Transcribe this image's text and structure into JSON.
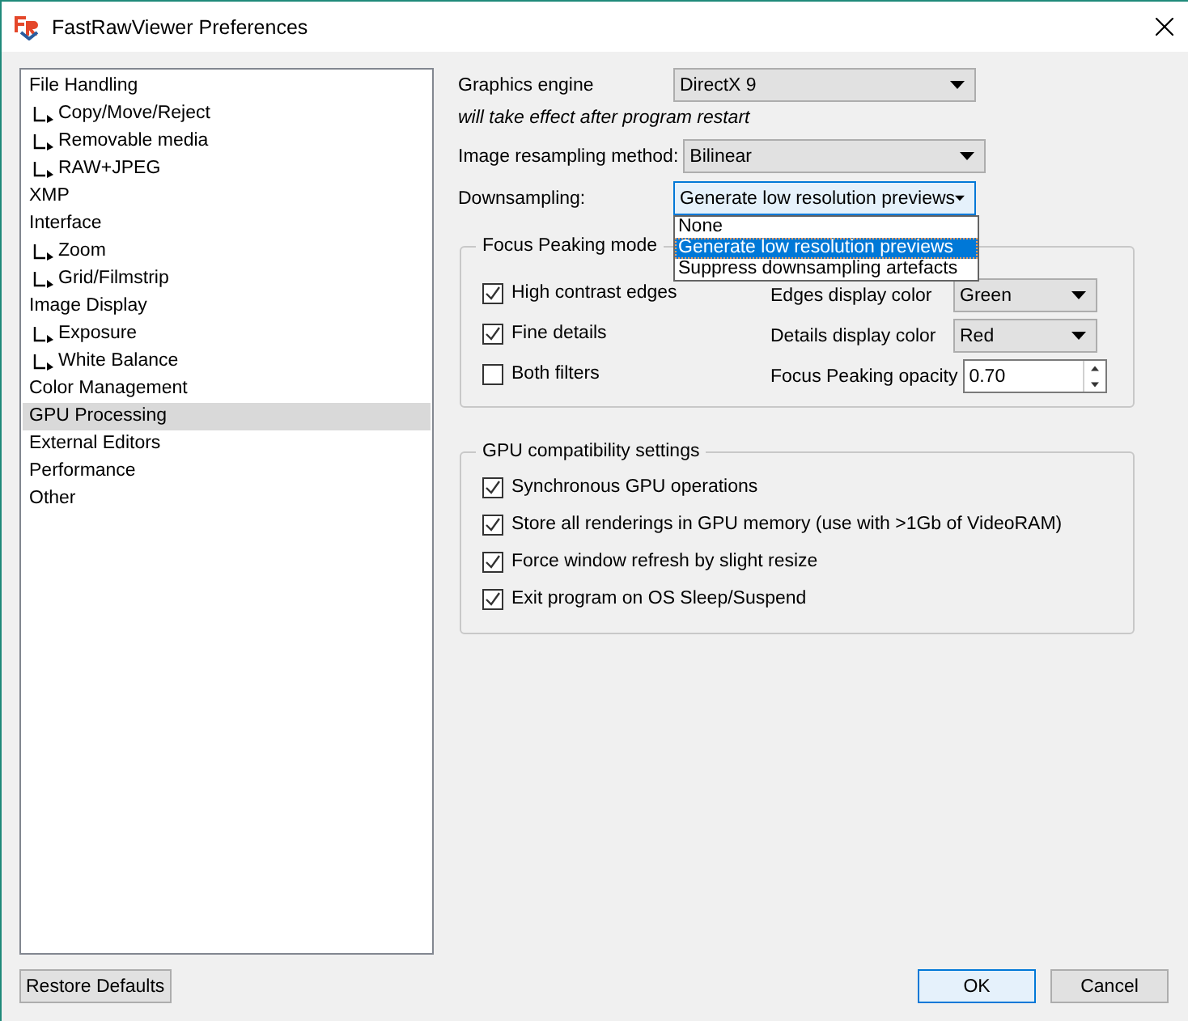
{
  "window": {
    "title": "FastRawViewer Preferences"
  },
  "sidebar": {
    "items": [
      {
        "label": "File Handling",
        "selected": false,
        "children": [
          {
            "label": "Copy/Move/Reject",
            "selected": false
          },
          {
            "label": "Removable media",
            "selected": false
          },
          {
            "label": "RAW+JPEG",
            "selected": false
          }
        ]
      },
      {
        "label": "XMP",
        "selected": false
      },
      {
        "label": "Interface",
        "selected": false,
        "children": [
          {
            "label": "Zoom",
            "selected": false
          },
          {
            "label": "Grid/Filmstrip",
            "selected": false
          }
        ]
      },
      {
        "label": "Image Display",
        "selected": false,
        "children": [
          {
            "label": "Exposure",
            "selected": false
          },
          {
            "label": "White Balance",
            "selected": false
          }
        ]
      },
      {
        "label": "Color Management",
        "selected": false
      },
      {
        "label": "GPU Processing",
        "selected": true
      },
      {
        "label": "External Editors",
        "selected": false
      },
      {
        "label": "Performance",
        "selected": false
      },
      {
        "label": "Other",
        "selected": false
      }
    ]
  },
  "graphics_engine": {
    "label": "Graphics engine",
    "value": "DirectX 9"
  },
  "note": "will take effect after program restart",
  "resampling": {
    "label": "Image resampling method:",
    "value": "Bilinear"
  },
  "downsampling": {
    "label": "Downsampling:",
    "value": "Generate low resolution previews",
    "expanded": true,
    "options": [
      {
        "label": "None",
        "selected": false
      },
      {
        "label": "Generate low resolution previews",
        "selected": true
      },
      {
        "label": "Suppress downsampling artefacts",
        "selected": false
      }
    ]
  },
  "focus_peaking": {
    "title": "Focus Peaking mode",
    "checkboxes": [
      {
        "label": "High contrast edges",
        "checked": true
      },
      {
        "label": "Fine details",
        "checked": true
      },
      {
        "label": "Both filters",
        "checked": false
      }
    ],
    "fields": [
      {
        "label": "Edges display color",
        "kind": "combo",
        "value": "Green"
      },
      {
        "label": "Details display color",
        "kind": "combo",
        "value": "Red"
      },
      {
        "label": "Focus Peaking opacity",
        "kind": "spin",
        "value": "0.70"
      }
    ]
  },
  "gpu_compatibility": {
    "title": "GPU compatibility settings",
    "checkboxes": [
      {
        "label": "Synchronous GPU operations",
        "checked": true
      },
      {
        "label": "Store all renderings in GPU memory (use with >1Gb of VideoRAM)",
        "checked": true
      },
      {
        "label": "Force window refresh by slight resize",
        "checked": true
      },
      {
        "label": "Exit program on OS Sleep/Suspend",
        "checked": true
      }
    ]
  },
  "footer": {
    "restore": "Restore Defaults",
    "buttons": [
      {
        "label": "OK",
        "default": true
      },
      {
        "label": "Cancel",
        "default": false
      }
    ]
  }
}
